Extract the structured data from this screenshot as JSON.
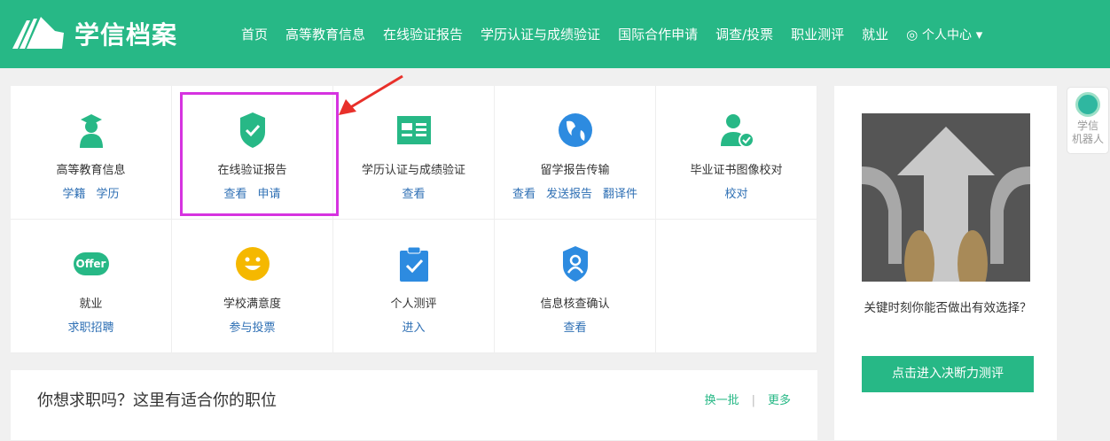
{
  "header": {
    "logo": "学信档案",
    "nav": [
      "首页",
      "高等教育信息",
      "在线验证报告",
      "学历认证与成绩验证",
      "国际合作申请",
      "调查/投票",
      "职业测评",
      "就业"
    ],
    "user": "个人中心"
  },
  "services": [
    {
      "label": "高等教育信息",
      "icon": "graduate-icon",
      "links": [
        "学籍",
        "学历"
      ]
    },
    {
      "label": "在线验证报告",
      "icon": "shield-check-icon",
      "links": [
        "查看",
        "申请"
      ]
    },
    {
      "label": "学历认证与成绩验证",
      "icon": "id-card-icon",
      "links": [
        "查看"
      ]
    },
    {
      "label": "留学报告传输",
      "icon": "globe-icon",
      "links": [
        "查看",
        "发送报告",
        "翻译件"
      ]
    },
    {
      "label": "毕业证书图像校对",
      "icon": "user-check-icon",
      "links": [
        "校对"
      ]
    },
    {
      "label": "就业",
      "icon": "offer-icon",
      "icon_text": "Offer",
      "links": [
        "求职招聘"
      ]
    },
    {
      "label": "学校满意度",
      "icon": "smile-icon",
      "links": [
        "参与投票"
      ]
    },
    {
      "label": "个人测评",
      "icon": "clipboard-check-icon",
      "links": [
        "进入"
      ]
    },
    {
      "label": "信息核查确认",
      "icon": "shield-user-icon",
      "links": [
        "查看"
      ]
    }
  ],
  "jobs": {
    "title": "你想求职吗？这里有适合你的职位",
    "refresh": "换一批",
    "sep": "|",
    "more": "更多"
  },
  "side": {
    "question": "关键时刻你能否做出有效选择？",
    "button": "点击进入决断力测评"
  },
  "robot": {
    "label1": "学信",
    "label2": "机器人"
  },
  "colors": {
    "brand": "#27b886",
    "link": "#2e6fb4",
    "highlight": "#d633e0",
    "arrow": "#e8302a"
  }
}
